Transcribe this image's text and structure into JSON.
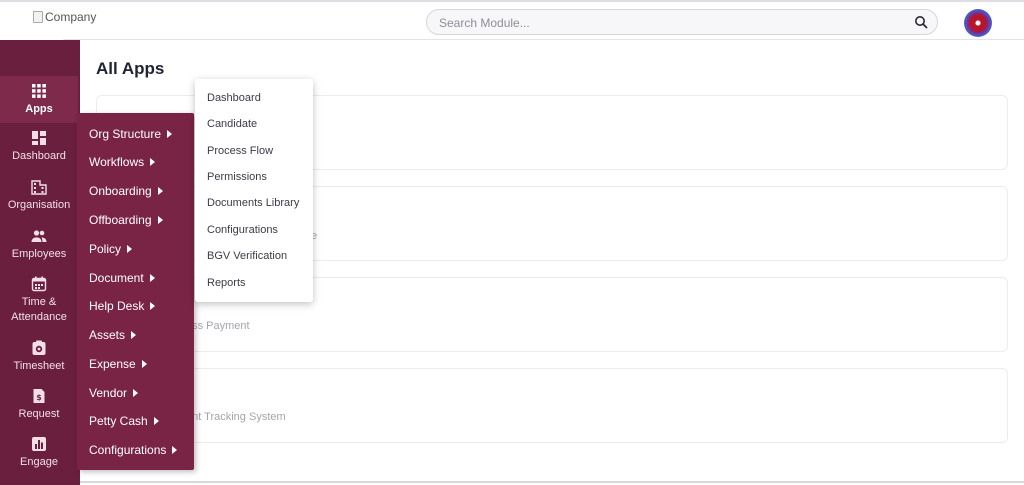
{
  "header": {
    "logo_alt": "Company",
    "search_placeholder": "Search Module..."
  },
  "sidebar": {
    "items": [
      {
        "label": "Apps",
        "icon": "grid-icon"
      },
      {
        "label": "Dashboard",
        "icon": "dashboard-icon"
      },
      {
        "label": "Organisation",
        "icon": "building-icon"
      },
      {
        "label": "Employees",
        "icon": "people-icon"
      },
      {
        "label": "Time & Attendance",
        "icon": "calendar-icon"
      },
      {
        "label": "Timesheet",
        "icon": "timesheet-icon"
      },
      {
        "label": "Request",
        "icon": "request-icon"
      },
      {
        "label": "Engage",
        "icon": "chart-icon"
      }
    ]
  },
  "main": {
    "title": "All Apps",
    "cards": [
      {
        "subtitle": ""
      },
      {
        "subtitle": "e"
      },
      {
        "subtitle": "ess Payment"
      },
      {
        "subtitle": "ant Tracking System"
      }
    ]
  },
  "apps_menu": {
    "items": [
      "Org Structure",
      "Workflows",
      "Onboarding",
      "Offboarding",
      "Policy",
      "Document",
      "Help Desk",
      "Assets",
      "Expense",
      "Vendor",
      "Petty Cash",
      "Configurations"
    ]
  },
  "flyout": {
    "items": [
      "Dashboard",
      "Candidate",
      "Process Flow",
      "Permissions",
      "Documents Library",
      "Configurations",
      "BGV Verification",
      "Reports"
    ]
  },
  "colors": {
    "rail": "#6b1f3f",
    "menu": "#7a2445",
    "active": "#7d2a4b"
  }
}
